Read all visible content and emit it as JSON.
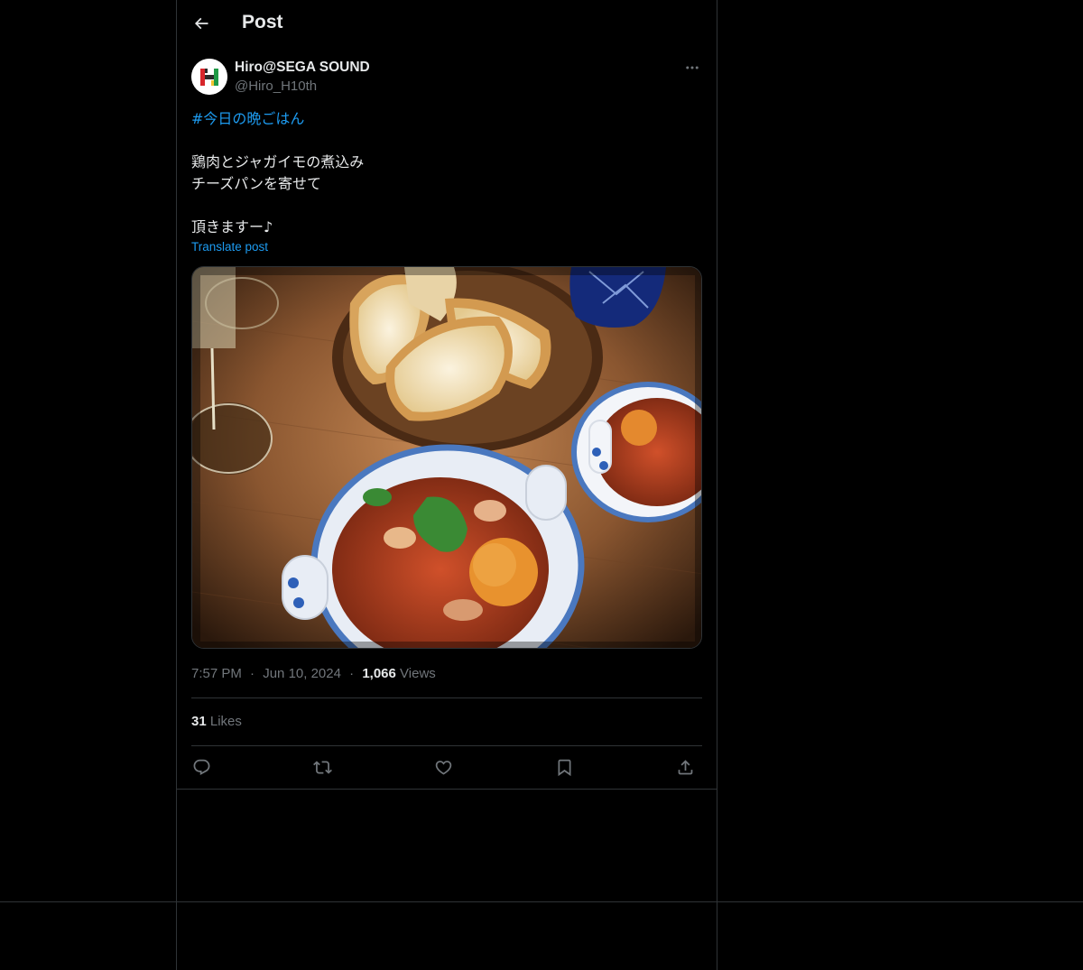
{
  "header": {
    "title": "Post"
  },
  "author": {
    "display_name": "Hiro@SEGA SOUND",
    "handle": "@Hiro_H10th",
    "avatar_letter": "H"
  },
  "post": {
    "hashtag": "#今日の晩ごはん",
    "lines": [
      "鶏肉とジャガイモの煮込み",
      "チーズパンを寄せて",
      "",
      "頂きますー♪"
    ],
    "translate_label": "Translate post"
  },
  "meta": {
    "time": "7:57 PM",
    "separator": "·",
    "date": "Jun 10, 2024",
    "views_count": "1,066",
    "views_label": "Views"
  },
  "stats": {
    "likes_count": "31",
    "likes_label": "Likes"
  },
  "colors": {
    "background": "#000000",
    "accent": "#1d9bf0",
    "border": "#2f3336",
    "secondary_text": "#71767b",
    "primary_text": "#e7e9ea"
  },
  "icons": {
    "back": "arrow-left-icon",
    "more": "more-horizontal-icon",
    "reply": "reply-icon",
    "repost": "repost-icon",
    "like": "heart-icon",
    "bookmark": "bookmark-icon",
    "share": "share-icon"
  }
}
